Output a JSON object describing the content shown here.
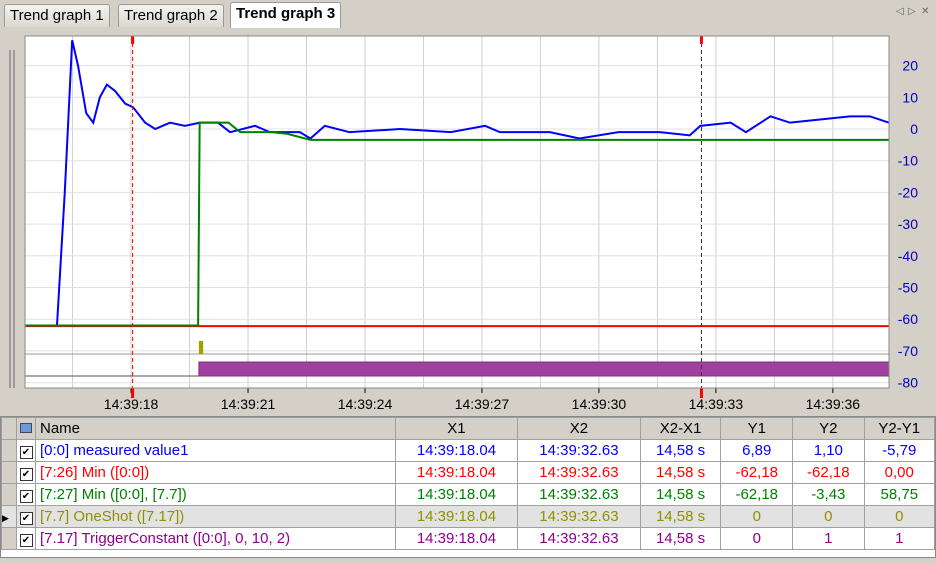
{
  "tabs": [
    "Trend graph 1",
    "Trend graph 2",
    "Trend graph 3"
  ],
  "active_tab": 2,
  "close_label": "x",
  "chart_data": {
    "type": "line",
    "y_ticks": [
      20,
      10,
      0,
      -10,
      -20,
      -30,
      -40,
      -50,
      -60,
      -70,
      -80
    ],
    "ylim": [
      -80,
      20
    ],
    "x_ticks": [
      "14:39:18",
      "14:39:21",
      "14:39:24",
      "14:39:27",
      "14:39:30",
      "14:39:33",
      "14:39:36"
    ],
    "x_tick_seconds": [
      18,
      21,
      24,
      27,
      30,
      33,
      36
    ],
    "xlim_seconds": [
      15.28,
      37.44
    ],
    "cursors": {
      "x1_seconds": 18.04,
      "x2_seconds": 32.63
    },
    "series": [
      {
        "name": "[0:0] measured value1",
        "color": "#0000ff",
        "t": [
          15.28,
          16.1,
          16.3,
          16.49,
          16.64,
          16.85,
          17.03,
          17.2,
          17.38,
          17.59,
          17.85,
          18.05,
          18.36,
          18.62,
          19,
          19.38,
          19.77,
          20.23,
          20.54,
          21.18,
          21.56,
          22.33,
          22.6,
          22.97,
          23.6,
          24.9,
          26.2,
          27.08,
          27.46,
          28.74,
          29.5,
          30.5,
          31.56,
          32.33,
          32.6,
          33.38,
          33.77,
          34.4,
          34.9,
          35.67,
          36.44,
          36.95,
          37.44
        ],
        "v": [
          -62,
          -62,
          -20,
          28,
          20,
          5,
          2,
          10,
          14,
          12,
          8,
          6.9,
          2,
          0,
          2,
          1,
          2,
          2,
          -1,
          1,
          -1,
          -1,
          -3,
          1,
          -1,
          0,
          -1,
          1,
          -1,
          -1,
          -3,
          -1,
          -1,
          -2,
          1,
          2,
          -1,
          4,
          2,
          3,
          4,
          4,
          2
        ]
      },
      {
        "name": "[7:26] Min ([0:0])",
        "color": "#ff0000",
        "t": [
          15.28,
          37.44
        ],
        "v": [
          -62.18,
          -62.18
        ]
      },
      {
        "name": "[7:27] Min ([0:0], [7.7])",
        "color": "#008000",
        "t": [
          15.28,
          19.72,
          19.76,
          20.5,
          20.8,
          21.6,
          22,
          22.6,
          37.44
        ],
        "v": [
          -62,
          -62,
          2,
          2,
          -1,
          -1,
          -1.5,
          -3.43,
          -3.43
        ]
      }
    ],
    "digital": [
      {
        "name": "[7.7] OneShot ([7.17])",
        "color": "#a0a000",
        "pulse_seconds": [
          19.74,
          19.85
        ]
      },
      {
        "name": "[7.17] TriggerConstant ([0:0], 0, 10, 2)",
        "color": "#a040a0",
        "on_from_seconds": 19.74
      }
    ]
  },
  "table": {
    "headers": [
      "Name",
      "X1",
      "X2",
      "X2-X1",
      "Y1",
      "Y2",
      "Y2-Y1"
    ],
    "rows": [
      {
        "color": "#0000ff",
        "cells": [
          "[0:0] measured value1",
          "14:39:18.04",
          "14:39:32.63",
          "14,58 s",
          "6,89",
          "1,10",
          "-5,79"
        ]
      },
      {
        "color": "#ff0000",
        "cells": [
          "[7:26] Min ([0:0])",
          "14:39:18.04",
          "14:39:32.63",
          "14,58 s",
          "-62,18",
          "-62,18",
          "0,00"
        ]
      },
      {
        "color": "#008000",
        "cells": [
          "[7:27] Min ([0:0], [7.7])",
          "14:39:18.04",
          "14:39:32.63",
          "14,58 s",
          "-62,18",
          "-3,43",
          "58,75"
        ]
      },
      {
        "color": "#909000",
        "cells": [
          "[7.7] OneShot ([7.17])",
          "14:39:18.04",
          "14:39:32.63",
          "14,58 s",
          "0",
          "0",
          "0"
        ]
      },
      {
        "color": "#900090",
        "cells": [
          "[7.17] TriggerConstant ([0:0], 0, 10, 2)",
          "14:39:18.04",
          "14:39:32.63",
          "14,58 s",
          "0",
          "1",
          "1"
        ]
      }
    ]
  }
}
